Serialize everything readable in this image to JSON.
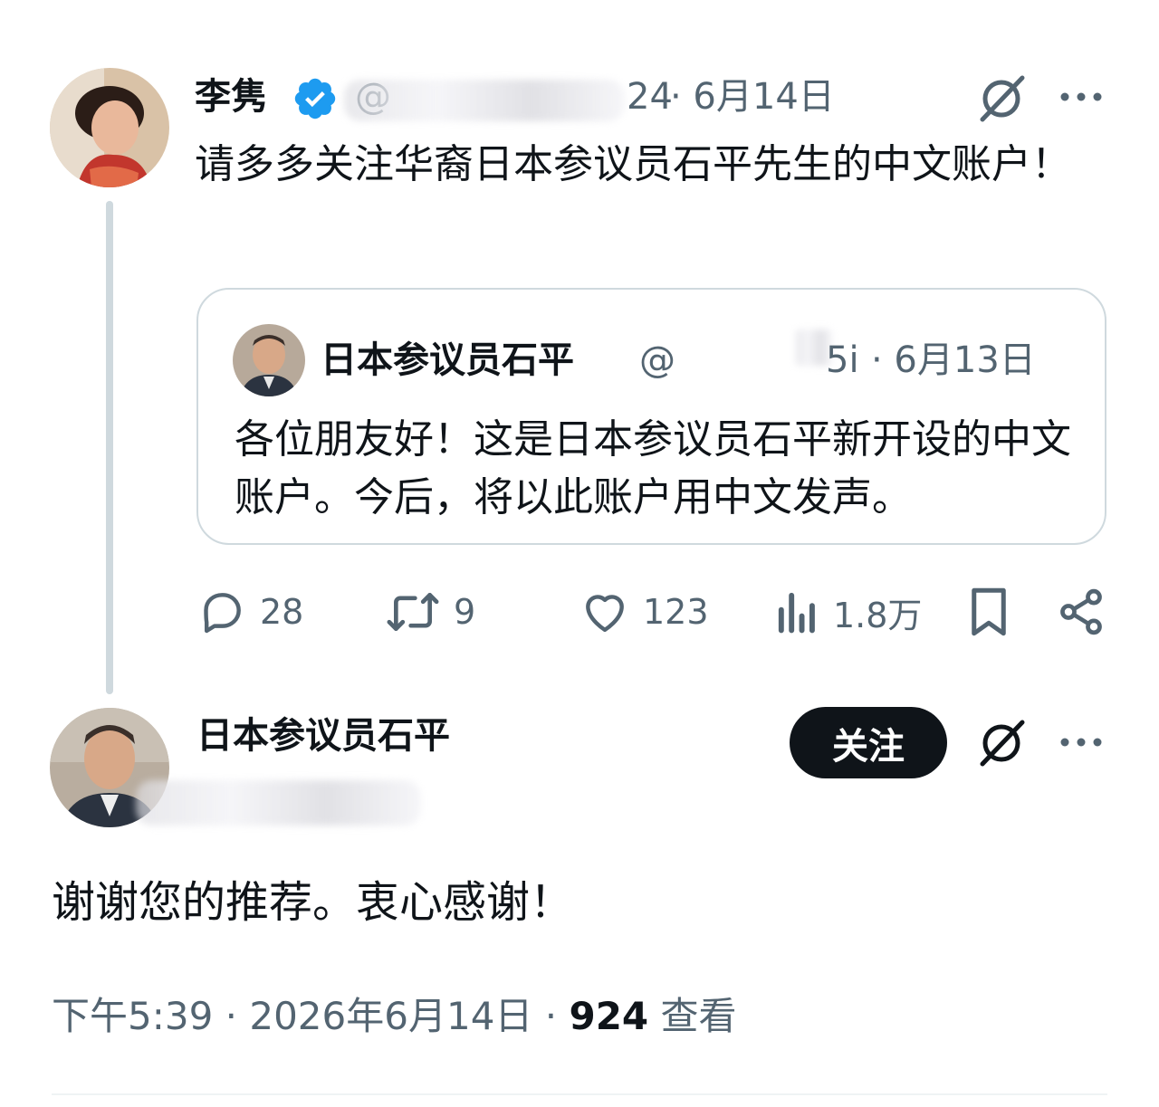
{
  "parent_tweet": {
    "display_name": "李隽",
    "handle_visible": "@",
    "handle_visible_suffix": "24",
    "date": "· 6月14日",
    "text": "请多多关注华裔日本参议员石平先生的中文账户！",
    "quoted_tweet": {
      "display_name": "日本参议员石平",
      "handle_visible": "@",
      "handle_visible_suffix": "5i",
      "date": "· 6月13日",
      "text": "各位朋友好！这是日本参议员石平新开设的中文账户。今后，将以此账户用中文发声。"
    },
    "actions": {
      "reply_count": "28",
      "retweet_count": "9",
      "like_count": "123",
      "views_count": "1.8万"
    }
  },
  "main_tweet": {
    "display_name": "日本参议员石平",
    "follow_label": "关注",
    "text": "谢谢您的推荐。衷心感谢！",
    "meta_time": "下午5:39 · 2026年6月14日 · ",
    "meta_views": "924",
    "meta_views_label": " 查看"
  },
  "colors": {
    "text_primary": "#0f1419",
    "text_secondary": "#536471",
    "verified_blue": "#1d9bf0",
    "border": "#cfd9de"
  },
  "icons": {
    "verified": "verified-badge-icon",
    "grok": "grok-icon",
    "more": "more-options-icon",
    "reply": "reply-icon",
    "retweet": "retweet-icon",
    "like": "like-icon",
    "views": "views-icon",
    "bookmark": "bookmark-icon",
    "share": "share-icon"
  }
}
